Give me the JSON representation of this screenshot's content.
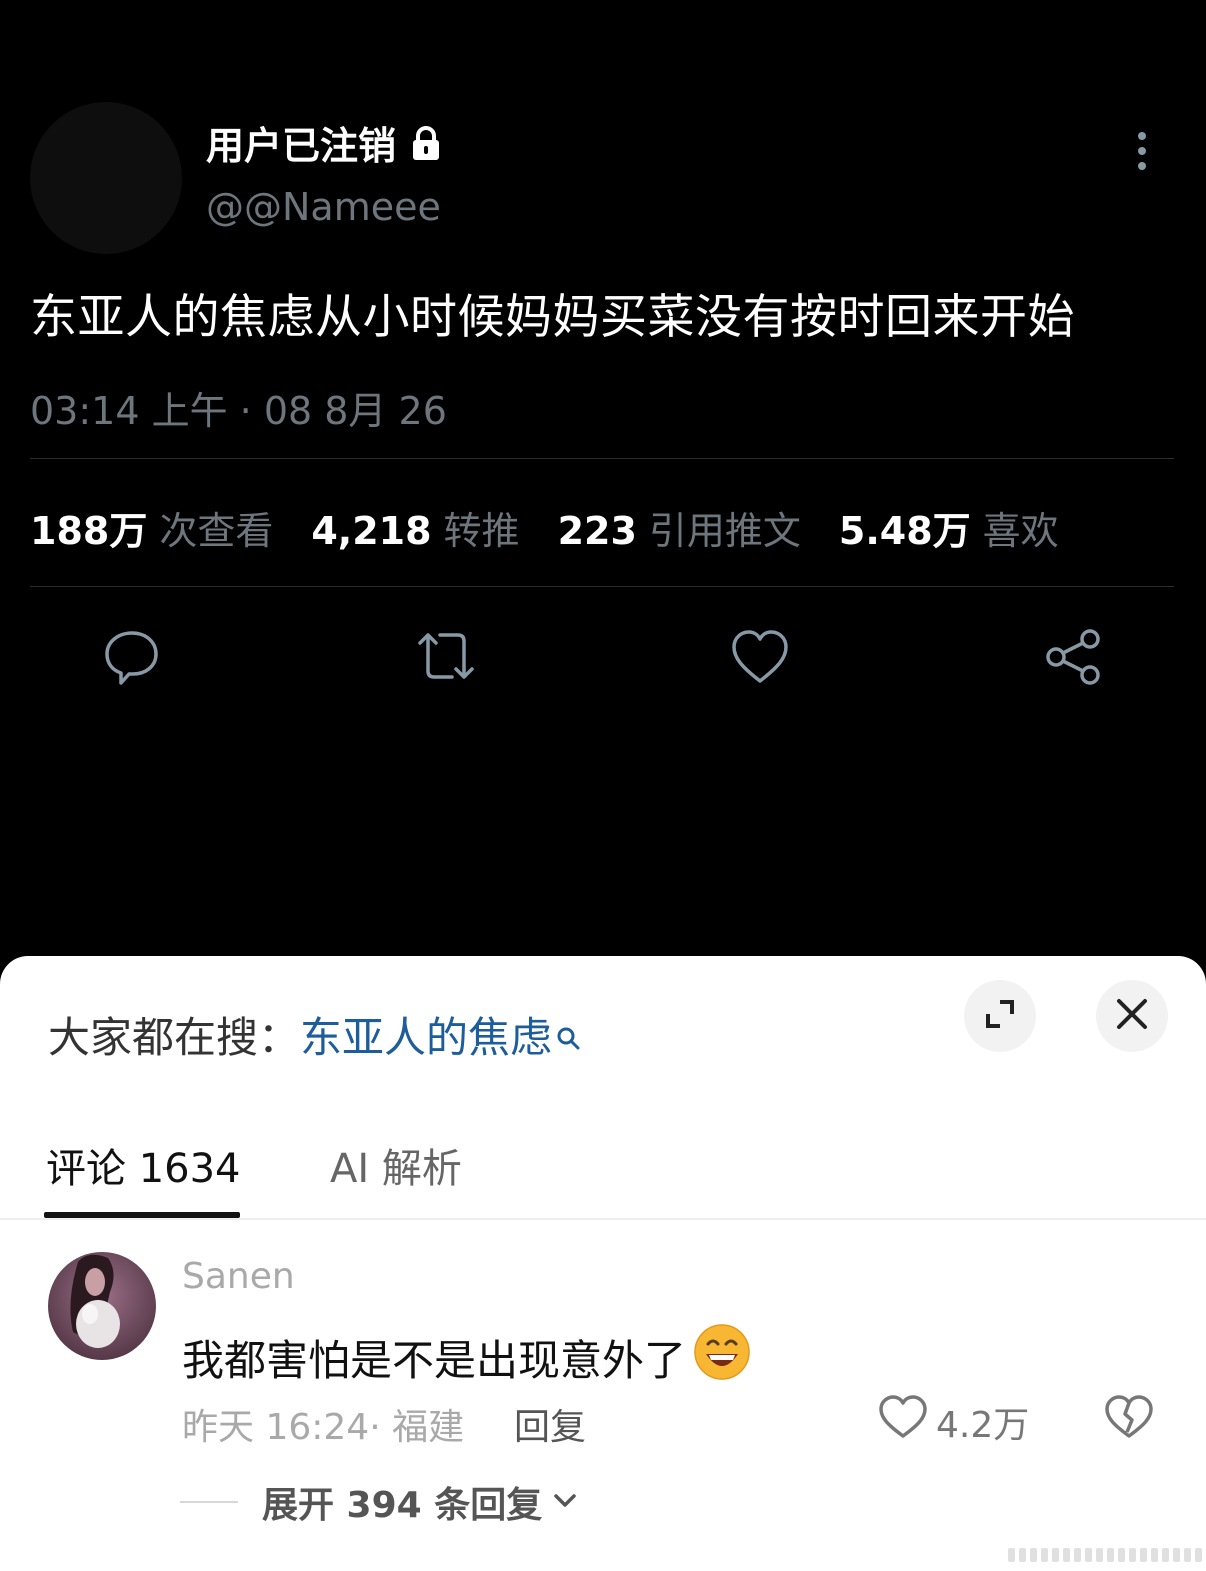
{
  "tweet": {
    "display_name": "用户已注销",
    "handle": "@@Nameee",
    "text": "东亚人的焦虑从小时候妈妈买菜没有按时回来开始",
    "timestamp": "03:14 上午 · 08 8月 26",
    "stats": [
      {
        "value": "188万",
        "label": "次查看"
      },
      {
        "value": "4,218",
        "label": "转推"
      },
      {
        "value": "223",
        "label": "引用推文"
      },
      {
        "value": "5.48万",
        "label": "喜欢"
      }
    ],
    "icons": [
      "lock-icon",
      "more-vertical-icon",
      "reply-icon",
      "retweet-icon",
      "like-icon",
      "share-icon"
    ],
    "colors": {
      "background": "#000000",
      "muted_text": "#6e767d",
      "icon_stroke": "#8899a6"
    }
  },
  "sheet": {
    "search_prefix": "大家都在搜：",
    "search_term": "东亚人的焦虑",
    "tabs": [
      {
        "label": "评论 1634",
        "active": true
      },
      {
        "label": "AI 解析",
        "active": false
      }
    ],
    "comment": {
      "username": "Sanen",
      "text": "我都害怕是不是出现意外了",
      "emoji": "grinning-face-emoji",
      "meta": "昨天 16:24· 福建",
      "reply_label": "回复",
      "like_count": "4.2万"
    },
    "expand_label": "展开 394 条回复",
    "colors": {
      "link": "#1d5d9b",
      "muted": "#a9a9a9"
    }
  }
}
